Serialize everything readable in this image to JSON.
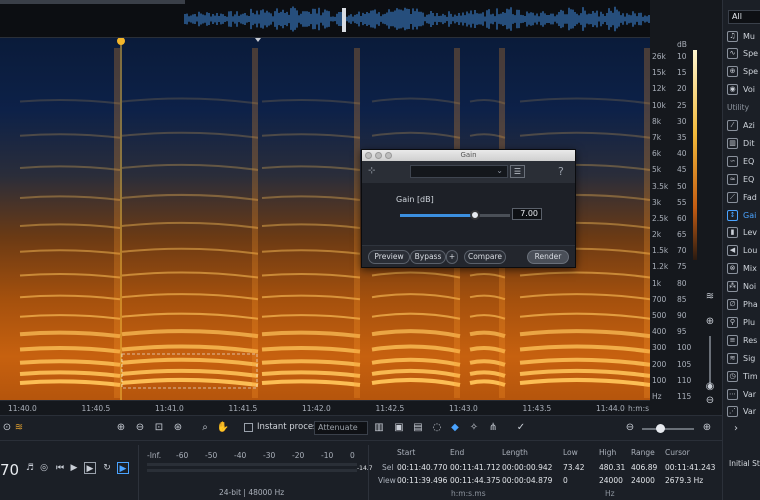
{
  "spectrogram": {
    "freq_ticks": [
      "26k",
      "15k",
      "12k",
      "10k",
      "8k",
      "7k",
      "6k",
      "5k",
      "3.5k",
      "3k",
      "2.5k",
      "2k",
      "1.5k",
      "1.2k",
      "1k",
      "700",
      "500",
      "400",
      "300",
      "200",
      "100",
      "Hz"
    ],
    "db_unit": "dB",
    "db_ticks": [
      "10",
      "15",
      "20",
      "25",
      "30",
      "35",
      "40",
      "45",
      "50",
      "55",
      "60",
      "65",
      "70",
      "75",
      "80",
      "85",
      "90",
      "95",
      "100",
      "105",
      "110",
      "115"
    ],
    "time_ticks": [
      "11:40.0",
      "11:40.5",
      "11:41.0",
      "11:41.5",
      "11:42.0",
      "11:42.5",
      "11:43.0",
      "11:43.5",
      "11:44.0"
    ],
    "time_unit": "h:m:s"
  },
  "dialog": {
    "title": "Gain",
    "help_label": "?",
    "menu_label": "☰",
    "param_label": "Gain [dB]",
    "gain_value": "7.00",
    "gain_level_fraction": 0.68,
    "buttons": {
      "preview": "Preview",
      "bypass": "Bypass",
      "add": "+",
      "compare": "Compare",
      "render": "Render"
    }
  },
  "sidebar": {
    "filter": "All",
    "modules": [
      {
        "label": "Mu",
        "icon": "♫"
      },
      {
        "label": "Spe",
        "icon": "∿"
      },
      {
        "label": "Spe",
        "icon": "⊕"
      },
      {
        "label": "Voi",
        "icon": "◉"
      },
      {
        "label": "Utility",
        "section": true
      },
      {
        "label": "Azi",
        "icon": "⁄"
      },
      {
        "label": "Dit",
        "icon": "▥"
      },
      {
        "label": "EQ",
        "icon": "∽"
      },
      {
        "label": "EQ",
        "icon": "≈"
      },
      {
        "label": "Fad",
        "icon": "⟋"
      },
      {
        "label": "Gai",
        "icon": "↕",
        "active": true
      },
      {
        "label": "Lev",
        "icon": "▮"
      },
      {
        "label": "Lou",
        "icon": "◀"
      },
      {
        "label": "Mix",
        "icon": "⊗"
      },
      {
        "label": "Noi",
        "icon": "⁂"
      },
      {
        "label": "Pha",
        "icon": "∅"
      },
      {
        "label": "Plu",
        "icon": "⚲"
      },
      {
        "label": "Res",
        "icon": "≡"
      },
      {
        "label": "Sig",
        "icon": "≋"
      },
      {
        "label": "Tim",
        "icon": "◷"
      },
      {
        "label": "Var",
        "icon": "⋯"
      },
      {
        "label": "Var",
        "icon": "⋰"
      }
    ]
  },
  "toolbar": {
    "instant_process": "Instant process",
    "attenuate": "Attenuate"
  },
  "transport": {
    "counter": "70"
  },
  "meter": {
    "ticks": [
      "-Inf.",
      "-60",
      "-50",
      "-40",
      "-30",
      "-20",
      "-10",
      "0"
    ],
    "peak": "-14.7",
    "format": "24-bit | 48000 Hz"
  },
  "info": {
    "headers": {
      "start": "Start",
      "end": "End",
      "length": "Length",
      "low": "Low",
      "high": "High",
      "range": "Range",
      "cursor": "Cursor"
    },
    "sel": {
      "label": "Sel",
      "start": "00:11:40.770",
      "end": "00:11:41.712",
      "length": "00:00:00.942",
      "low": "73.42",
      "high": "480.31",
      "range": "406.89",
      "cursor": "00:11:41.243"
    },
    "view": {
      "label": "View",
      "start": "00:11:39.496",
      "end": "00:11:44.375",
      "length": "00:00:04.879",
      "low": "0",
      "high": "24000",
      "range": "24000",
      "cursor": "2679.3 Hz"
    },
    "time_unit": "h:m:s.ms",
    "freq_unit": "Hz"
  },
  "history": {
    "label": "Initial Sta"
  }
}
